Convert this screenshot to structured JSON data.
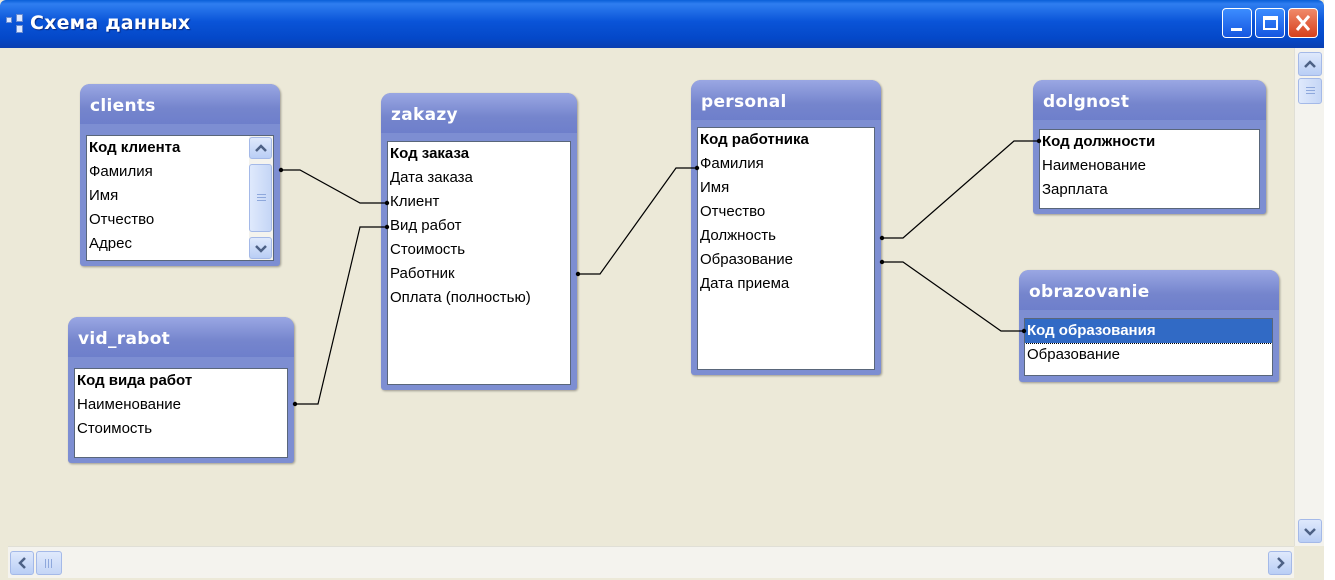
{
  "window": {
    "title": "Схема данных",
    "accent": "#0a54d8",
    "close_color": "#d6401c"
  },
  "controls": {
    "minimize_icon": "minimize-icon",
    "maximize_icon": "maximize-icon",
    "close_icon": "close-icon"
  },
  "tables": {
    "clients": {
      "name": "clients",
      "fields": [
        "Код клиента",
        "Фамилия",
        "Имя",
        "Отчество",
        "Адрес"
      ],
      "key_field": "Код клиента"
    },
    "vid_rabot": {
      "name": "vid_rabot",
      "fields": [
        "Код вида работ",
        "Наименование",
        "Стоимость"
      ],
      "key_field": "Код вида работ"
    },
    "zakazy": {
      "name": "zakazy",
      "fields": [
        "Код заказа",
        "Дата заказа",
        "Клиент",
        "Вид работ",
        "Стоимость",
        "Работник",
        "Оплата (полностью)"
      ],
      "key_field": "Код заказа"
    },
    "personal": {
      "name": "personal",
      "fields": [
        "Код работника",
        "Фамилия",
        "Имя",
        "Отчество",
        "Должность",
        "Образование",
        "Дата приема"
      ],
      "key_field": "Код работника"
    },
    "dolgnost": {
      "name": "dolgnost",
      "fields": [
        "Код должности",
        "Наименование",
        "Зарплата"
      ],
      "key_field": "Код должности"
    },
    "obrazovanie": {
      "name": "obrazovanie",
      "fields": [
        "Код образования",
        "Образование"
      ],
      "key_field": "Код образования",
      "selected_field": "Код образования"
    }
  },
  "relationships": [
    {
      "from": "clients.Код клиента",
      "to": "zakazy.Клиент"
    },
    {
      "from": "vid_rabot.Код вида работ",
      "to": "zakazy.Вид работ"
    },
    {
      "from": "zakazy.Работник",
      "to": "personal.Код работника"
    },
    {
      "from": "personal.Должность",
      "to": "dolgnost.Код должности"
    },
    {
      "from": "personal.Образование",
      "to": "obrazovanie.Код образования"
    }
  ],
  "colors": {
    "table_header": "#7585cd",
    "selection": "#316ac5",
    "canvas": "#ece9d8"
  }
}
